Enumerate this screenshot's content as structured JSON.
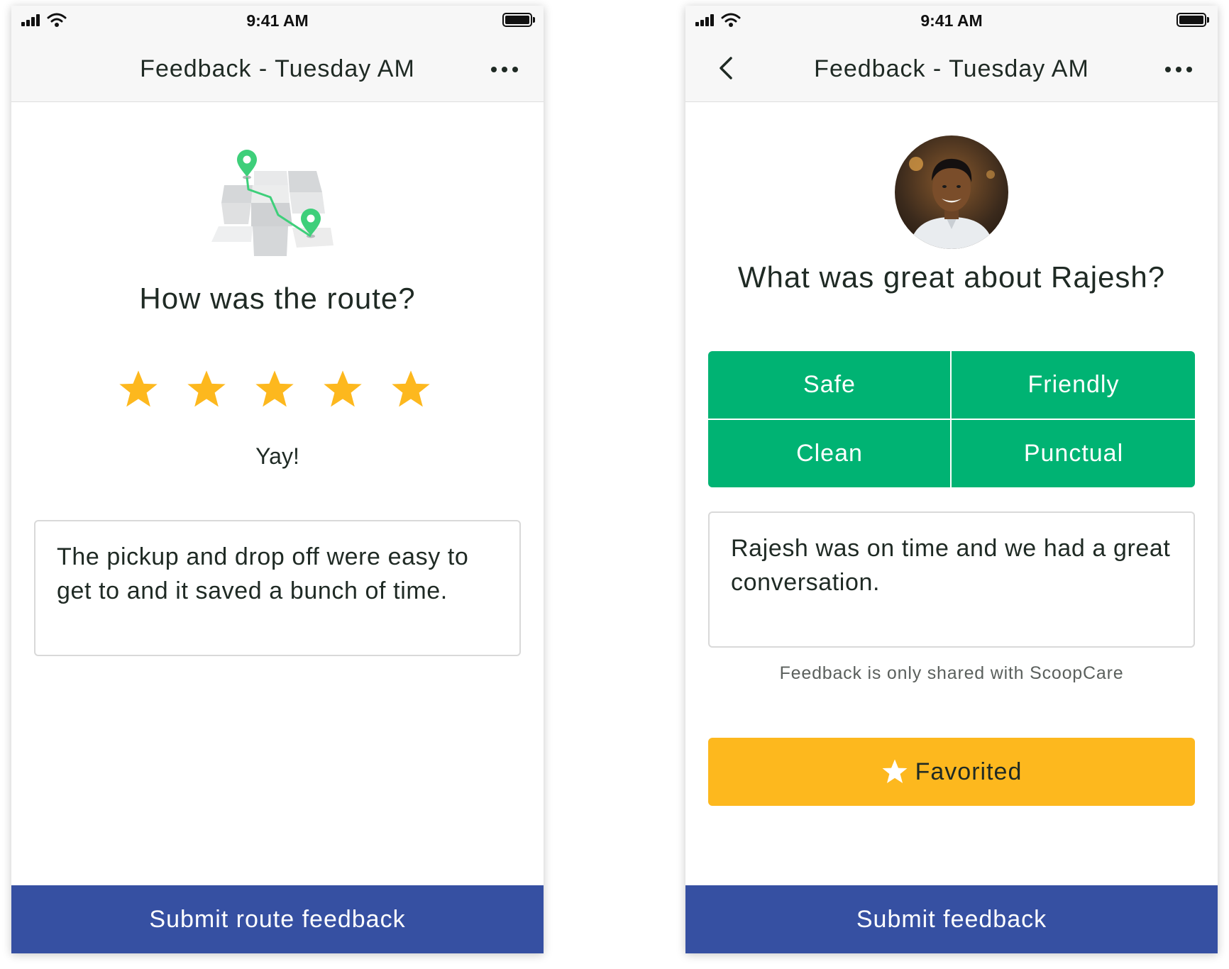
{
  "colors": {
    "brand_green": "#00b373",
    "star_yellow": "#fdb81e",
    "submit_blue": "#3650a2",
    "map_pin_green": "#3ecf7a"
  },
  "left_screen": {
    "status_bar": {
      "time": "9:41 AM"
    },
    "header": {
      "title": "Feedback - Tuesday AM",
      "more_icon": "more-horizontal-icon"
    },
    "illustration": "map-route-illustration",
    "question": "How was the route?",
    "rating": {
      "value": 5,
      "max": 5,
      "label": "Yay!"
    },
    "comment": "The pickup and drop off were easy to get to and it saved a bunch of time.",
    "submit_label": "Submit route feedback"
  },
  "right_screen": {
    "status_bar": {
      "time": "9:41 AM"
    },
    "header": {
      "title": "Feedback - Tuesday AM",
      "back_icon": "chevron-left-icon",
      "more_icon": "more-horizontal-icon"
    },
    "avatar": "driver-avatar-photo",
    "question": "What was great about Rajesh?",
    "tags": [
      "Safe",
      "Friendly",
      "Clean",
      "Punctual"
    ],
    "comment": "Rajesh was on time and we had a great conversation.",
    "privacy_note": "Feedback is only shared with ScoopCare",
    "favorite_button": {
      "label": "Favorited",
      "icon": "star-icon"
    },
    "submit_label": "Submit feedback"
  }
}
